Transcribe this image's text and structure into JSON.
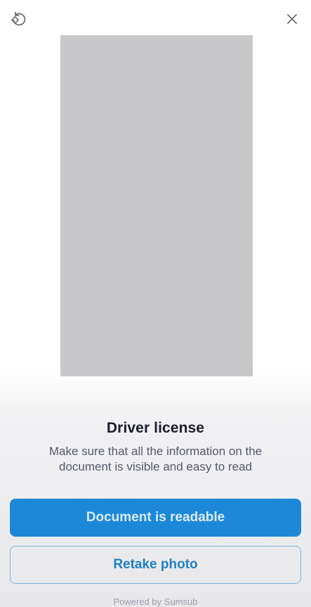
{
  "header": {
    "rotate_icon": "rotate-icon",
    "close_icon": "close-icon"
  },
  "document": {
    "title": "Driver license",
    "description": "Make sure that all the information on the document is visible and easy to read"
  },
  "actions": {
    "primary_label": "Document is readable",
    "secondary_label": "Retake photo"
  },
  "footer": {
    "powered_by": "Powered by Sumsub"
  },
  "colors": {
    "accent": "#1e88d8",
    "preview_placeholder": "#c8c8ca"
  }
}
